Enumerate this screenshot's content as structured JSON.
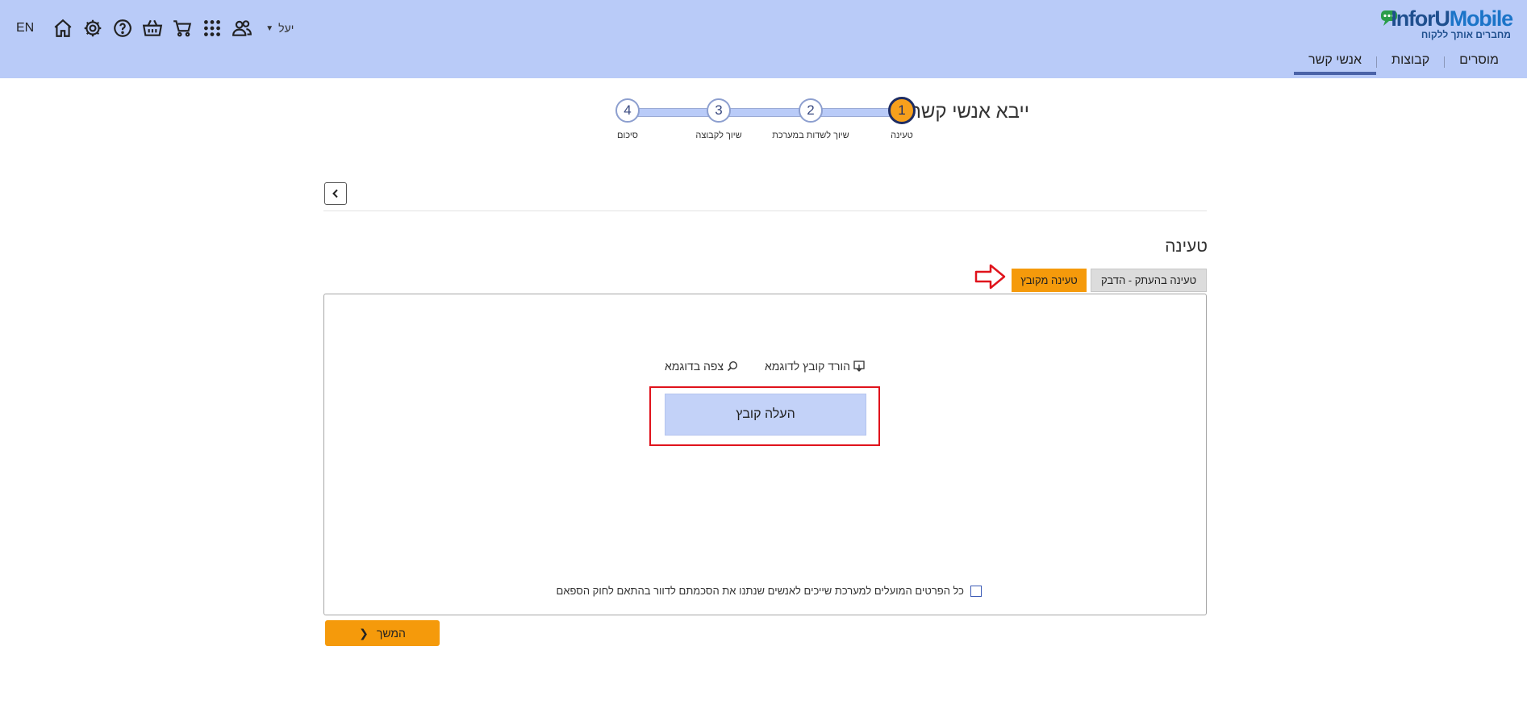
{
  "header": {
    "logo": {
      "name_dark": "InforU",
      "name_light": "Mobile",
      "tagline": "מחברים אותך ללקוח"
    },
    "user_name": "יעל",
    "language": "EN",
    "tools": [
      "home-icon",
      "settings-icon",
      "help-icon",
      "basket-icon",
      "cart-icon",
      "apps-grid-icon",
      "users-icon"
    ],
    "nav": [
      {
        "label": "אנשי קשר",
        "active": true
      },
      {
        "label": "קבוצות",
        "active": false
      },
      {
        "label": "מוסרים",
        "active": false
      }
    ]
  },
  "wizard": {
    "title": "ייבא אנשי קשר",
    "steps": [
      {
        "number": "1",
        "label": "טעינה",
        "current": true
      },
      {
        "number": "2",
        "label": "שיוך לשדות במערכת",
        "current": false
      },
      {
        "number": "3",
        "label": "שיוך לקבוצה",
        "current": false
      },
      {
        "number": "4",
        "label": "סיכום",
        "current": false
      }
    ]
  },
  "load": {
    "title": "טעינה",
    "tab_paste": "טעינה בהעתק - הדבק",
    "tab_file": "טעינה מקובץ",
    "download_sample": "הורד קובץ לדוגמא",
    "view_sample": "צפה בדוגמא",
    "upload_button": "העלה קובץ",
    "consent_text": "כל הפרטים המועלים למערכת שייכים לאנשים שנתנו את הסכמתם לדוור בהתאם לחוק הספאם",
    "consent_checked": false,
    "continue_button": "המשך"
  },
  "colors": {
    "header_bg": "#b9cbf8",
    "accent_orange": "#f59a0b",
    "upload_bg": "#c3d2f8",
    "highlight_red": "#e0131c"
  }
}
